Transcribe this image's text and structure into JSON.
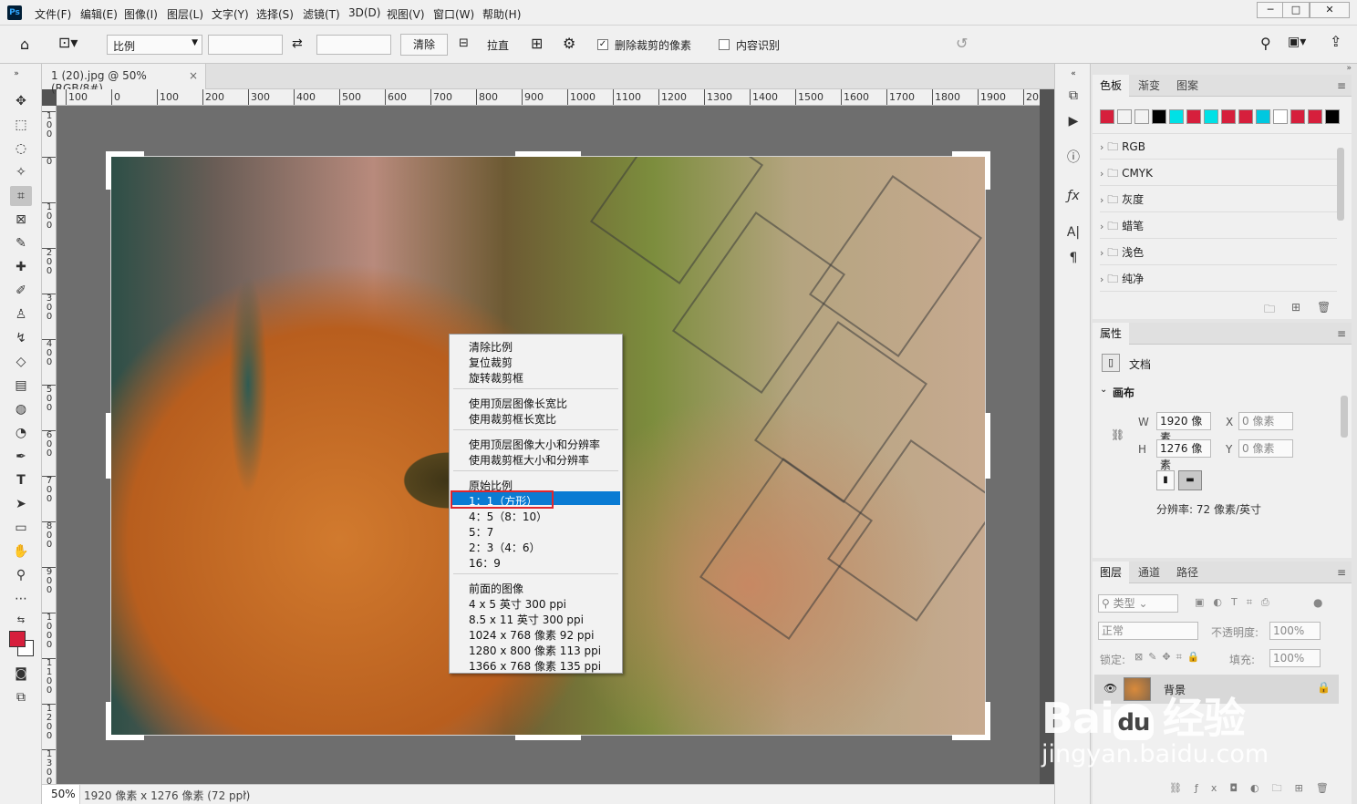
{
  "app": {
    "logo": "Ps"
  },
  "menu": [
    "文件(F)",
    "编辑(E)",
    "图像(I)",
    "图层(L)",
    "文字(Y)",
    "选择(S)",
    "滤镜(T)",
    "3D(D)",
    "视图(V)",
    "窗口(W)",
    "帮助(H)"
  ],
  "window_controls": [
    "─",
    "□",
    "✕"
  ],
  "options": {
    "ratio_select": "比例",
    "clear_button": "清除",
    "straighten_label": "拉直",
    "delete_cropped_label": "删除裁剪的像素",
    "delete_cropped_checked": true,
    "content_aware_label": "内容识别",
    "content_aware_checked": false
  },
  "document": {
    "tab_title": "1 (20).jpg @ 50%(RGB/8#)",
    "tab_close": "×"
  },
  "ruler_h": [
    "100",
    "0",
    "100",
    "200",
    "300",
    "400",
    "500",
    "600",
    "700",
    "800",
    "900",
    "1000",
    "1100",
    "1200",
    "1300",
    "1400",
    "1500",
    "1600",
    "1700",
    "1800",
    "1900",
    "20"
  ],
  "ruler_v": [
    "1\n0\n0",
    "0",
    "1\n0\n0",
    "2\n0\n0",
    "3\n0\n0",
    "4\n0\n0",
    "5\n0\n0",
    "6\n0\n0",
    "7\n0\n0",
    "8\n0\n0",
    "9\n0\n0",
    "1\n0\n0\n0",
    "1\n1\n0\n0",
    "1\n2\n0\n0",
    "1\n3\n0\n0"
  ],
  "status": {
    "zoom": "50%",
    "info": "1920 像素 x 1276 像素 (72 ppi)",
    "arrow": "›"
  },
  "context_menu": {
    "group1": [
      "清除比例",
      "复位裁剪",
      "旋转裁剪框"
    ],
    "group2": [
      "使用顶层图像长宽比",
      "使用裁剪框长宽比"
    ],
    "group3": [
      "使用顶层图像大小和分辨率",
      "使用裁剪框大小和分辨率"
    ],
    "group4": [
      "原始比例",
      "1：1（方形）",
      "4：5（8：10）",
      "5：7",
      "2：3（4：6）",
      "16：9"
    ],
    "group5": [
      "前面的图像",
      "4 x 5 英寸 300 ppi",
      "8.5 x 11 英寸 300 ppi",
      "1024 x 768 像素 92 ppi",
      "1280 x 800 像素 113 ppi",
      "1366 x 768 像素 135 ppi"
    ],
    "highlighted": "1：1（方形）"
  },
  "swatches_panel": {
    "tabs": [
      "色板",
      "渐变",
      "图案"
    ],
    "colors": [
      "#d61f3c",
      "#f2f2f2",
      "#f2f2f2",
      "#000000",
      "#00e1e6",
      "#d61f3c",
      "#00e1e6",
      "#d61f3c",
      "#d61f3c",
      "#00c8e0",
      "#ffffff",
      "#d61f3c",
      "#d61f3c",
      "#000000"
    ],
    "groups": [
      "RGB",
      "CMYK",
      "灰度",
      "蜡笔",
      "浅色",
      "纯净"
    ]
  },
  "properties_panel": {
    "tab": "属性",
    "doc_label": "文档",
    "canvas_label": "画布",
    "w_label": "W",
    "w_value": "1920 像素",
    "h_label": "H",
    "h_value": "1276 像素",
    "x_label": "X",
    "x_value": "0 像素",
    "y_label": "Y",
    "y_value": "0 像素",
    "resolution": "分辨率: 72 像素/英寸"
  },
  "layers_panel": {
    "tabs": [
      "图层",
      "通道",
      "路径"
    ],
    "filter_label": "类型",
    "blend_mode": "正常",
    "opacity_label": "不透明度:",
    "opacity_value": "100%",
    "lock_label": "锁定:",
    "fill_label": "填充:",
    "fill_value": "100%",
    "layer_name": "背景"
  },
  "watermark": {
    "brand": "Bai",
    "brand2": "du",
    "cn": "经验",
    "url": "jingyan.baidu.com"
  }
}
